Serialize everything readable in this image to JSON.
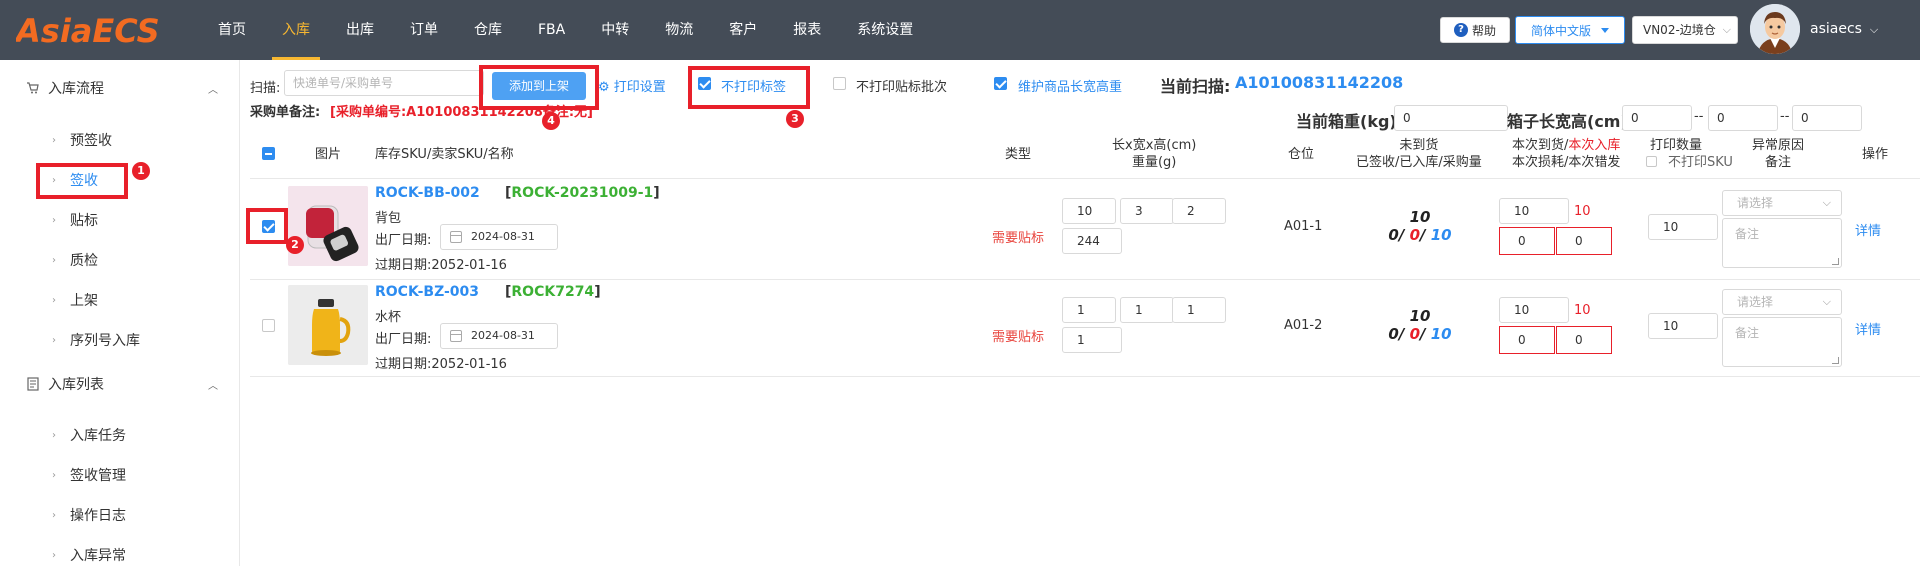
{
  "app": {
    "brand": "AsiaECS",
    "brand_color": "#f36b21"
  },
  "nav": {
    "items": [
      "首页",
      "入库",
      "出库",
      "订单",
      "仓库",
      "FBA",
      "中转",
      "物流",
      "客户",
      "报表",
      "系统设置"
    ],
    "active": "入库"
  },
  "header": {
    "help": "帮助",
    "language": "简体中文版",
    "warehouse": "VN02-边境仓",
    "username": "asiaecs"
  },
  "sidebar": {
    "groups": [
      {
        "label": "入库流程",
        "items": [
          "预签收",
          "签收",
          "贴标",
          "质检",
          "上架",
          "序列号入库"
        ]
      },
      {
        "label": "入库列表",
        "items": [
          "入库任务",
          "签收管理",
          "操作日志",
          "入库异常"
        ]
      }
    ],
    "active_item": "签收"
  },
  "toolbar": {
    "scan_label": "扫描:",
    "scan_placeholder": "快递单号/采购单号",
    "add_to_shelf": "添加到上架",
    "print_settings": "打印设置",
    "no_print_label": "不打印标签",
    "no_print_label_checked": true,
    "no_print_batch": "不打印贴标批次",
    "no_print_batch_checked": false,
    "maintain_dims": "维护商品长宽高重",
    "maintain_dims_checked": true,
    "current_scan_label": "当前扫描:",
    "current_scan_value": "A10100831142208"
  },
  "po_remark": {
    "label": "采购单备注:",
    "value": "[采购单编号:A10100831142208备注:无]"
  },
  "box": {
    "weight_label": "当前箱重(kg):",
    "weight": "0",
    "dims_label": "箱子长宽高(cm):",
    "l": "0",
    "w": "0",
    "h": "0",
    "sep": "--"
  },
  "table": {
    "headers": {
      "image": "图片",
      "sku": "库存SKU/卖家SKU/名称",
      "type": "类型",
      "dims_1": "长x宽x高(cm)",
      "dims_2": "重量(g)",
      "location": "仓位",
      "pending_1": "未到货",
      "pending_2": "已签收/已入库/采购量",
      "arrival_1a": "本次到货/",
      "arrival_1b": "本次入库",
      "arrival_2": "本次损耗/本次错发",
      "print_qty": "打印数量",
      "no_print_sku": "不打印SKU",
      "exception_1": "异常原因",
      "exception_2": "备注",
      "action": "操作"
    },
    "rows": [
      {
        "checked": true,
        "sku": "ROCK-BB-002",
        "seller_sku": "ROCK-20231009-1",
        "name": "背包",
        "mfg_label": "出厂日期:",
        "mfg_date": "2024-08-31",
        "exp_label": "过期日期:",
        "exp_date": "2052-01-16",
        "type": "需要贴标",
        "length": "10",
        "width": "3",
        "height": "2",
        "weight": "244",
        "location": "A01-1",
        "pending": "10",
        "signed": "0",
        "stocked": "0",
        "purchased": "10",
        "arrival": "10",
        "stock_in": "10",
        "loss": "0",
        "wrong": "0",
        "print_qty": "10",
        "reason_placeholder": "请选择",
        "remark_placeholder": "备注",
        "action": "详情"
      },
      {
        "checked": false,
        "sku": "ROCK-BZ-003",
        "seller_sku": "ROCK7274",
        "name": "水杯",
        "mfg_label": "出厂日期:",
        "mfg_date": "2024-08-31",
        "exp_label": "过期日期:",
        "exp_date": "2052-01-16",
        "type": "需要贴标",
        "length": "1",
        "width": "1",
        "height": "1",
        "weight": "1",
        "location": "A01-2",
        "pending": "10",
        "signed": "0",
        "stocked": "0",
        "purchased": "10",
        "arrival": "10",
        "stock_in": "10",
        "loss": "0",
        "wrong": "0",
        "print_qty": "10",
        "reason_placeholder": "请选择",
        "remark_placeholder": "备注",
        "action": "详情"
      }
    ]
  },
  "annotations": [
    "1",
    "2",
    "3",
    "4"
  ]
}
